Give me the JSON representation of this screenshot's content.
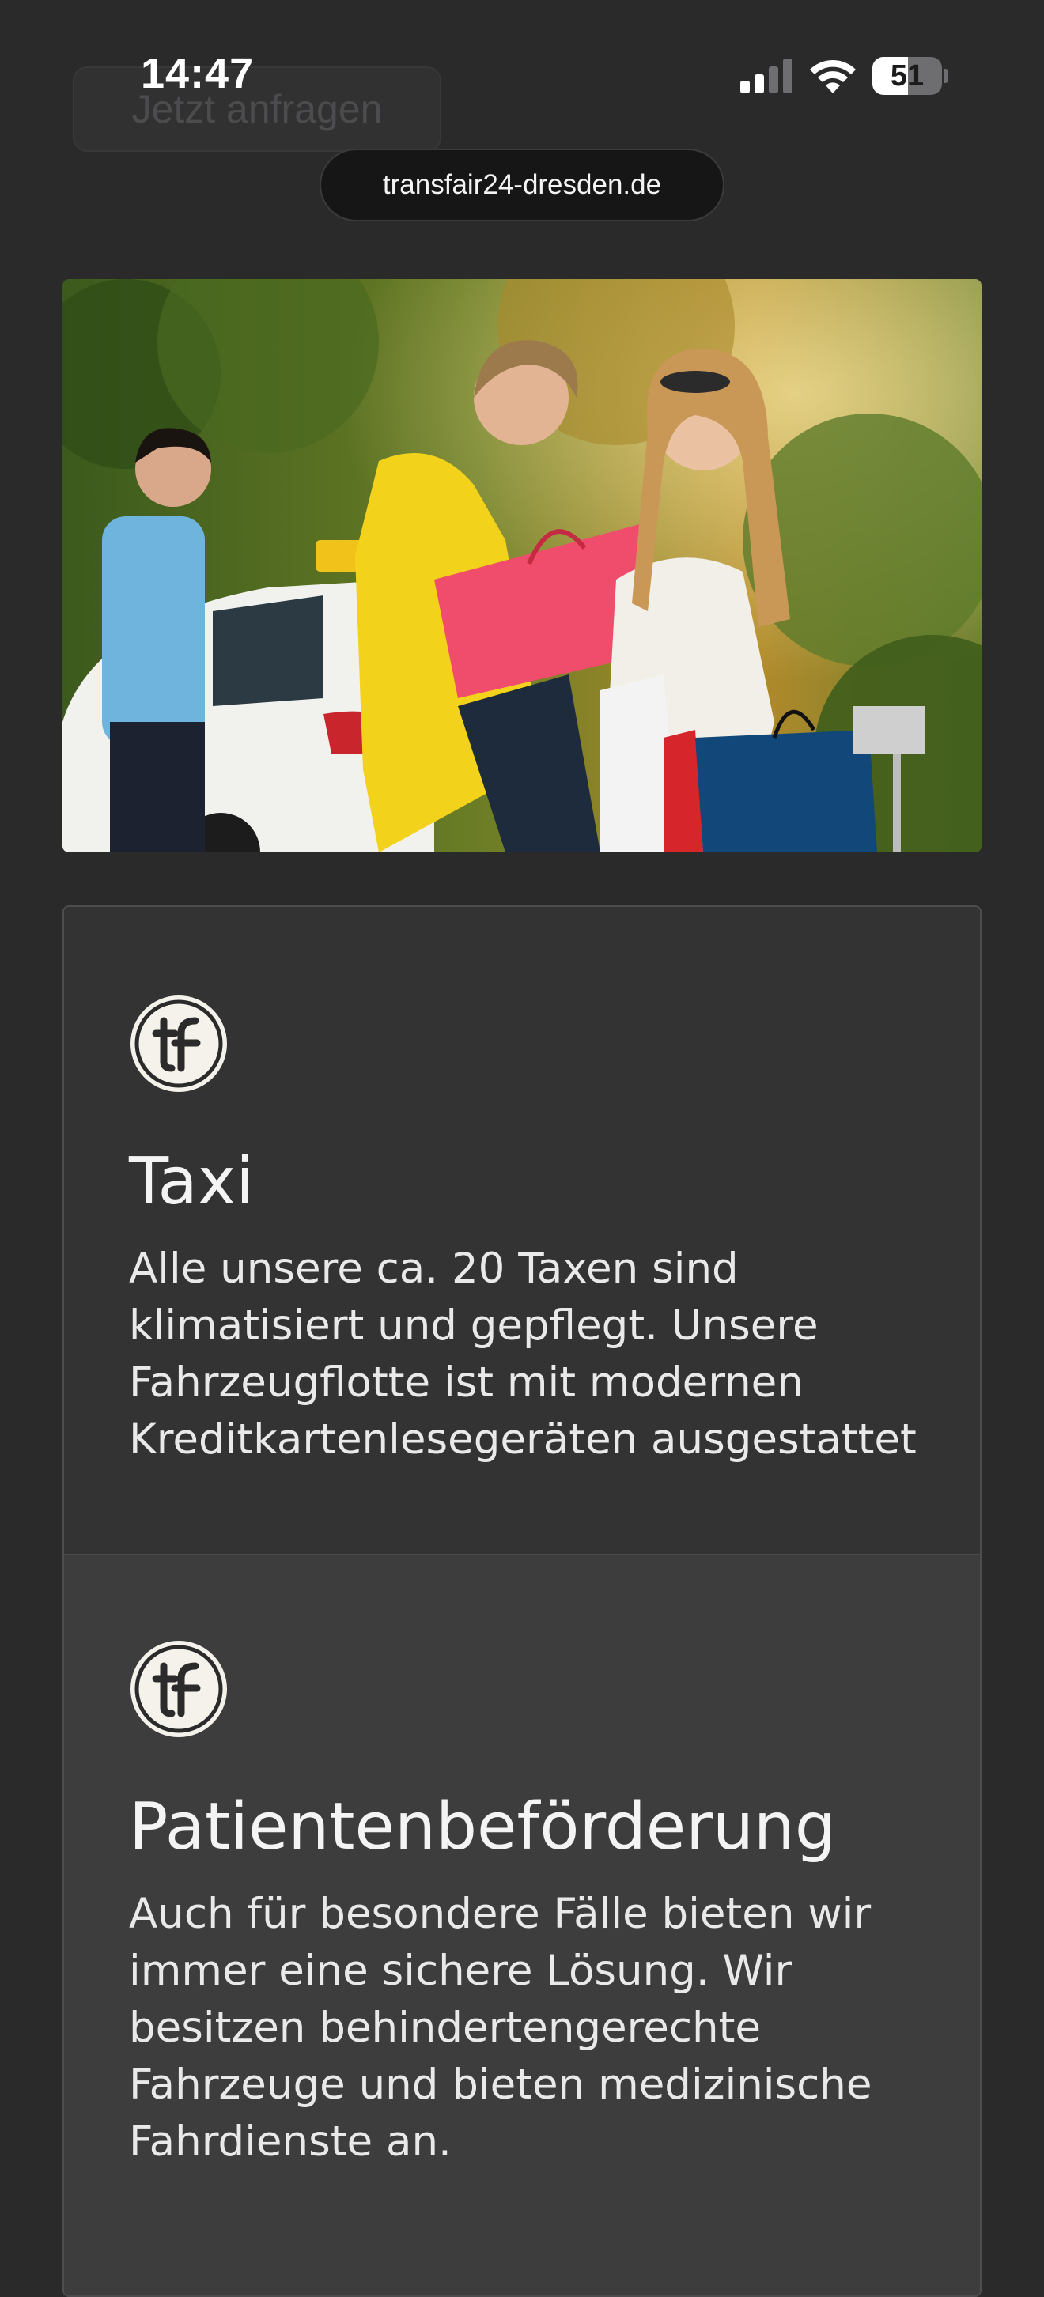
{
  "status_bar": {
    "time": "14:47",
    "battery": "51",
    "battery_level": 0.51,
    "signal_icon": "cellular-signal-icon",
    "wifi_icon": "wifi-icon"
  },
  "browser": {
    "url": "transfair24-dresden.de"
  },
  "header": {
    "request_button_label": "Jetzt anfragen"
  },
  "hero": {
    "image": "taxi-driver-and-two-women-with-shopping-bags-photo"
  },
  "services": [
    {
      "logo": "tf-logo-icon",
      "title": "Taxi",
      "text": "Alle unsere ca. 20 Taxen sind klimatisiert und gepflegt. Unsere Fahrzeugflotte ist mit modernen Kreditkartenlesegeräten ausgestattet"
    },
    {
      "logo": "tf-logo-icon",
      "title": "Patientenbeförderung",
      "text": "Auch für besondere Fälle bieten wir immer eine sichere Lösung. Wir besitzen behindertengerechte Fahrzeuge und bieten medizinische Fahrdienste an."
    }
  ],
  "colors": {
    "background": "#2a2a2b",
    "card_dark": "#333334",
    "card_light": "#3d3d3e",
    "text": "#f4f4f4"
  }
}
